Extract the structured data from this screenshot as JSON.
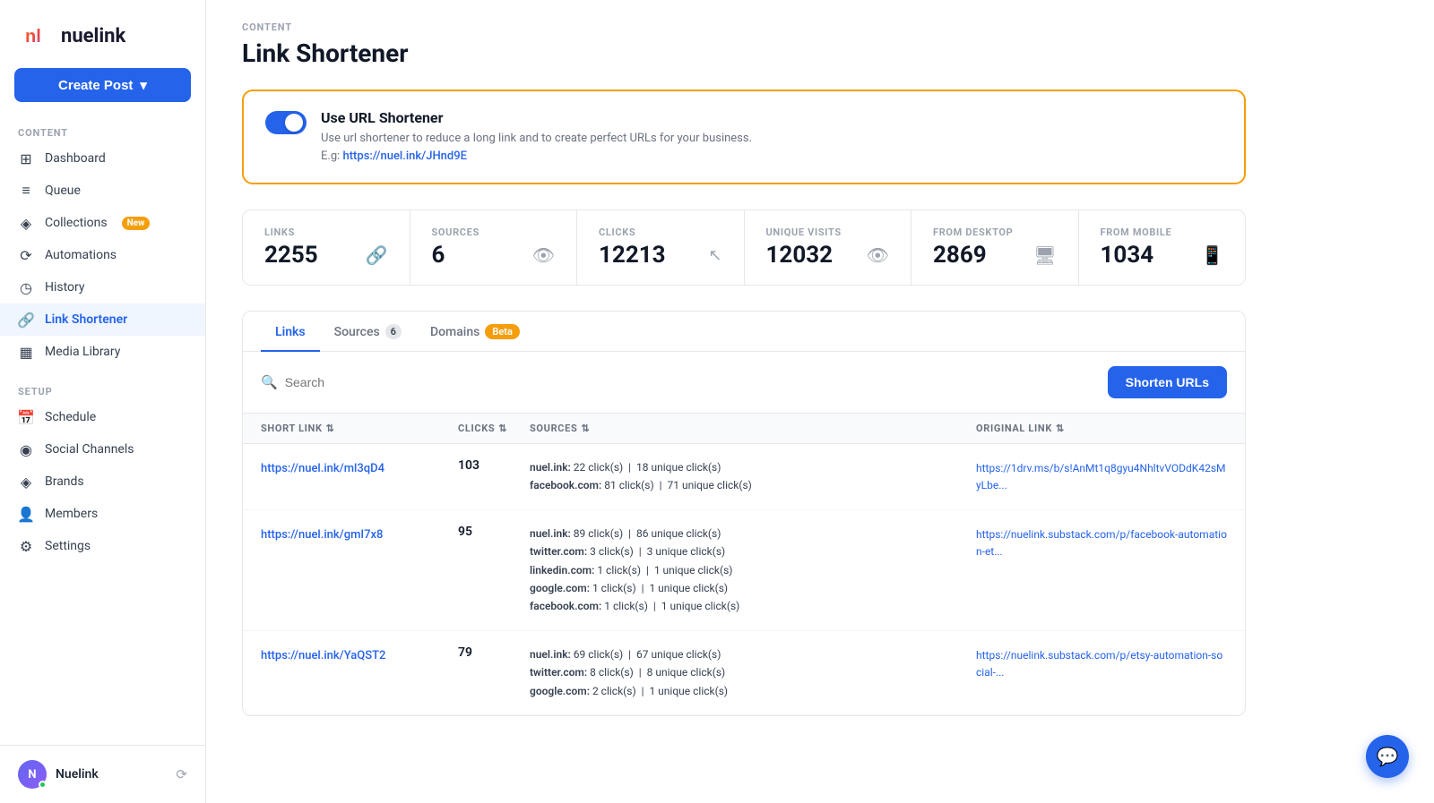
{
  "sidebar": {
    "logo_text": "nuelink",
    "create_post_label": "Create Post",
    "sections": [
      {
        "label": "CONTENT",
        "items": [
          {
            "id": "dashboard",
            "label": "Dashboard",
            "icon": "⊞",
            "active": false
          },
          {
            "id": "queue",
            "label": "Queue",
            "icon": "≡",
            "active": false
          },
          {
            "id": "collections",
            "label": "Collections",
            "icon": "◈",
            "active": false,
            "badge": "New"
          },
          {
            "id": "automations",
            "label": "Automations",
            "icon": "⟳",
            "active": false
          },
          {
            "id": "history",
            "label": "History",
            "icon": "◷",
            "active": false
          },
          {
            "id": "link-shortener",
            "label": "Link Shortener",
            "icon": "🔗",
            "active": true
          },
          {
            "id": "media-library",
            "label": "Media Library",
            "icon": "▦",
            "active": false
          }
        ]
      },
      {
        "label": "SETUP",
        "items": [
          {
            "id": "schedule",
            "label": "Schedule",
            "icon": "📅",
            "active": false
          },
          {
            "id": "social-channels",
            "label": "Social Channels",
            "icon": "◉",
            "active": false
          },
          {
            "id": "brands",
            "label": "Brands",
            "icon": "◈",
            "active": false
          },
          {
            "id": "members",
            "label": "Members",
            "icon": "👤",
            "active": false
          },
          {
            "id": "settings",
            "label": "Settings",
            "icon": "⚙",
            "active": false
          }
        ]
      }
    ],
    "user": {
      "name": "Nuelink",
      "initials": "N"
    }
  },
  "breadcrumb": "CONTENT",
  "page_title": "Link Shortener",
  "url_shortener_card": {
    "toggle_on": true,
    "title": "Use URL Shortener",
    "description": "Use url shortener to reduce a long link and to create perfect URLs for your business.",
    "example_label": "E.g:",
    "example_url": "https://nuel.ink/JHnd9E"
  },
  "stats": [
    {
      "label": "LINKS",
      "value": "2255",
      "icon": "🔗"
    },
    {
      "label": "SOURCES",
      "value": "6",
      "icon": "👁"
    },
    {
      "label": "CLICKS",
      "value": "12213",
      "icon": "↖"
    },
    {
      "label": "UNIQUE VISITS",
      "value": "12032",
      "icon": "👁"
    },
    {
      "label": "FROM DESKTOP",
      "value": "2869",
      "icon": "🖥"
    },
    {
      "label": "FROM MOBILE",
      "value": "1034",
      "icon": "📱"
    }
  ],
  "tabs": [
    {
      "label": "Links",
      "active": true,
      "badge": null,
      "badge_type": null
    },
    {
      "label": "Sources",
      "active": false,
      "badge": "6",
      "badge_type": "count"
    },
    {
      "label": "Domains",
      "active": false,
      "badge": "Beta",
      "badge_type": "beta"
    }
  ],
  "search": {
    "placeholder": "Search"
  },
  "shorten_btn_label": "Shorten URLs",
  "table": {
    "columns": [
      "SHORT LINK",
      "CLICKS",
      "SOURCES",
      "ORIGINAL LINK"
    ],
    "rows": [
      {
        "short_link": "https://nuel.ink/ml3qD4",
        "clicks": "103",
        "sources": [
          {
            "name": "nuel.ink",
            "clicks": "22 click(s)",
            "unique": "18 unique click(s)"
          },
          {
            "name": "facebook.com",
            "clicks": "81 click(s)",
            "unique": "71 unique click(s)"
          }
        ],
        "original_link": "https://1drv.ms/b/s!AnMt1q8gyu4NhltvVODdK42sMyLbe..."
      },
      {
        "short_link": "https://nuel.ink/gmI7x8",
        "clicks": "95",
        "sources": [
          {
            "name": "nuel.ink",
            "clicks": "89 click(s)",
            "unique": "86 unique click(s)"
          },
          {
            "name": "twitter.com",
            "clicks": "3 click(s)",
            "unique": "3 unique click(s)"
          },
          {
            "name": "linkedin.com",
            "clicks": "1 click(s)",
            "unique": "1 unique click(s)"
          },
          {
            "name": "google.com",
            "clicks": "1 click(s)",
            "unique": "1 unique click(s)"
          },
          {
            "name": "facebook.com",
            "clicks": "1 click(s)",
            "unique": "1 unique click(s)"
          }
        ],
        "original_link": "https://nuelink.substack.com/p/facebook-automation-et..."
      },
      {
        "short_link": "https://nuel.ink/YaQST2",
        "clicks": "79",
        "sources": [
          {
            "name": "nuel.ink",
            "clicks": "69 click(s)",
            "unique": "67 unique click(s)"
          },
          {
            "name": "twitter.com",
            "clicks": "8 click(s)",
            "unique": "8 unique click(s)"
          },
          {
            "name": "google.com",
            "clicks": "2 click(s)",
            "unique": "1 unique click(s)"
          }
        ],
        "original_link": "https://nuelink.substack.com/p/etsy-automation-social-..."
      }
    ]
  },
  "chat_button_icon": "💬"
}
